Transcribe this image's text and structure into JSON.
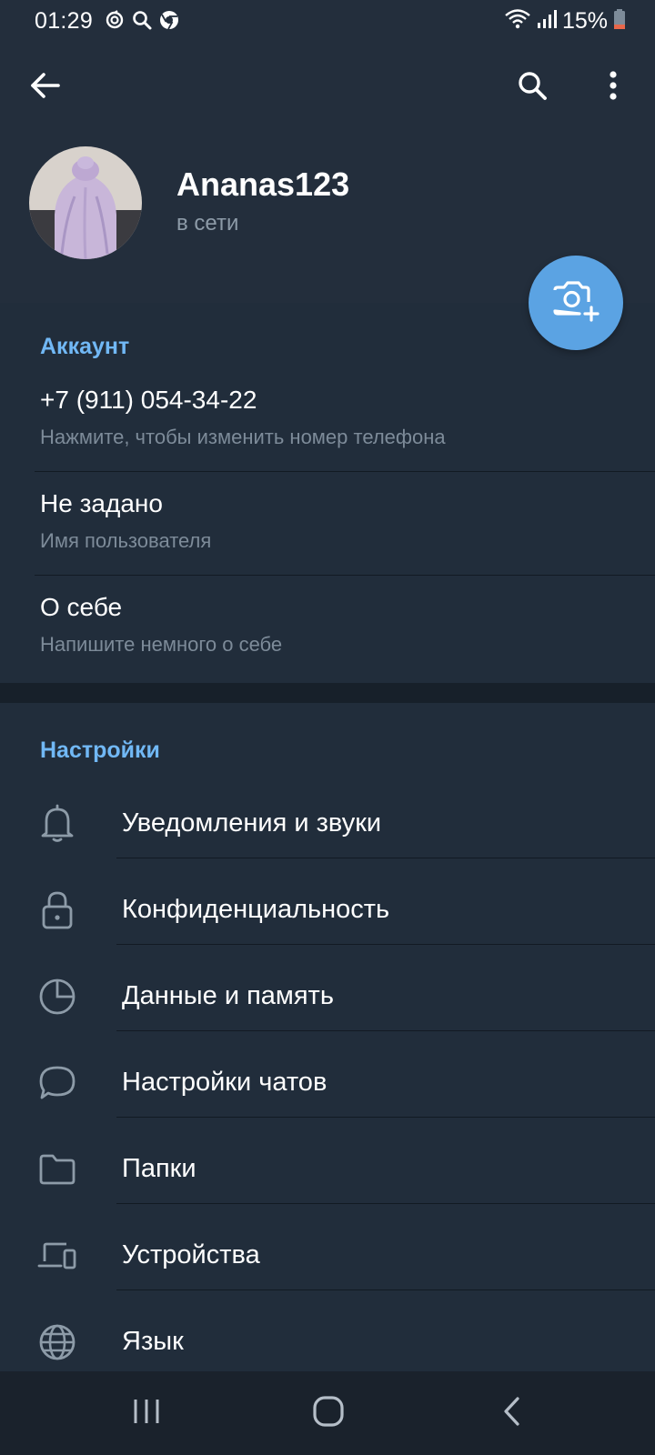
{
  "status_bar": {
    "time": "01:29",
    "battery": "15%",
    "icons": [
      "sync-icon",
      "search-icon",
      "chrome-icon",
      "wifi-icon",
      "signal-icon",
      "battery-icon"
    ]
  },
  "toolbar": {
    "back_icon": "arrow-left-icon",
    "search_icon": "search-icon",
    "menu_icon": "more-vertical-icon"
  },
  "profile": {
    "name": "Ananas123",
    "status": "в сети",
    "fab_icon": "camera-add-icon"
  },
  "account": {
    "title": "Аккаунт",
    "items": [
      {
        "value": "+7 (911) 054-34-22",
        "hint": "Нажмите, чтобы изменить номер телефона"
      },
      {
        "value": "Не задано",
        "hint": "Имя пользователя"
      },
      {
        "value": "О себе",
        "hint": "Напишите немного о себе"
      }
    ]
  },
  "settings": {
    "title": "Настройки",
    "items": [
      {
        "label": "Уведомления и звуки",
        "icon": "bell-icon"
      },
      {
        "label": "Конфиденциальность",
        "icon": "lock-icon"
      },
      {
        "label": "Данные и память",
        "icon": "pie-chart-icon"
      },
      {
        "label": "Настройки чатов",
        "icon": "chat-bubble-icon"
      },
      {
        "label": "Папки",
        "icon": "folder-icon"
      },
      {
        "label": "Устройства",
        "icon": "devices-icon"
      },
      {
        "label": "Язык",
        "icon": "globe-icon"
      }
    ]
  },
  "nav_bar": {
    "icons": [
      "recent-apps-icon",
      "home-icon",
      "back-icon"
    ]
  },
  "colors": {
    "background": "#1d2733",
    "header": "#232e3c",
    "accent": "#71b8f5",
    "fab": "#5ba3e3",
    "battery_low": "#e8674a"
  }
}
